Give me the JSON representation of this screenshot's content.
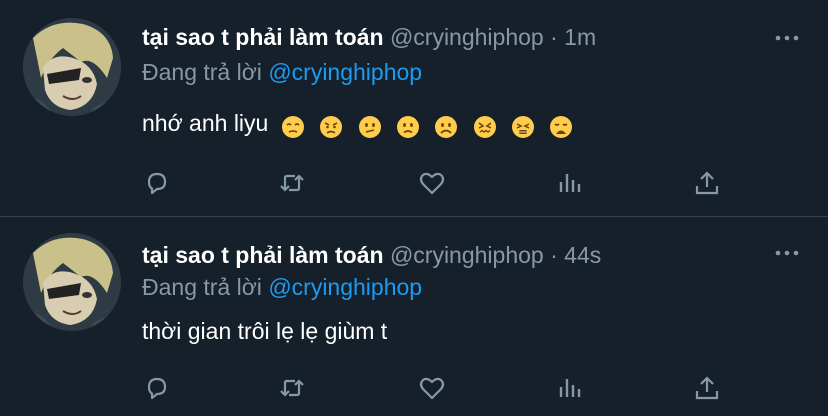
{
  "tweets": [
    {
      "display_name": "tại sao t phải làm toán",
      "handle": "@cryinghiphop",
      "separator": "·",
      "time": "1m",
      "reply_prefix": "Đang trả lời",
      "reply_to": "@cryinghiphop",
      "text": "nhớ anh liyu",
      "emojis": [
        "pensive-face",
        "persevering-face",
        "confused-face",
        "slightly-frowning-face",
        "frowning-face",
        "confounded-face",
        "persevering-squint-face",
        "weary-face"
      ]
    },
    {
      "display_name": "tại sao t phải làm toán",
      "handle": "@cryinghiphop",
      "separator": "·",
      "time": "44s",
      "reply_prefix": "Đang trả lời",
      "reply_to": "@cryinghiphop",
      "text": "thời gian trôi lẹ lẹ giùm t",
      "emojis": []
    }
  ],
  "icons": [
    "more-icon",
    "reply-icon",
    "retweet-icon",
    "like-icon",
    "analytics-icon",
    "share-icon"
  ],
  "colors": {
    "background": "#15202b",
    "divider": "#38444d",
    "secondary_text": "#8899a6",
    "mention": "#1d9bf0",
    "icon": "#8899a6"
  }
}
